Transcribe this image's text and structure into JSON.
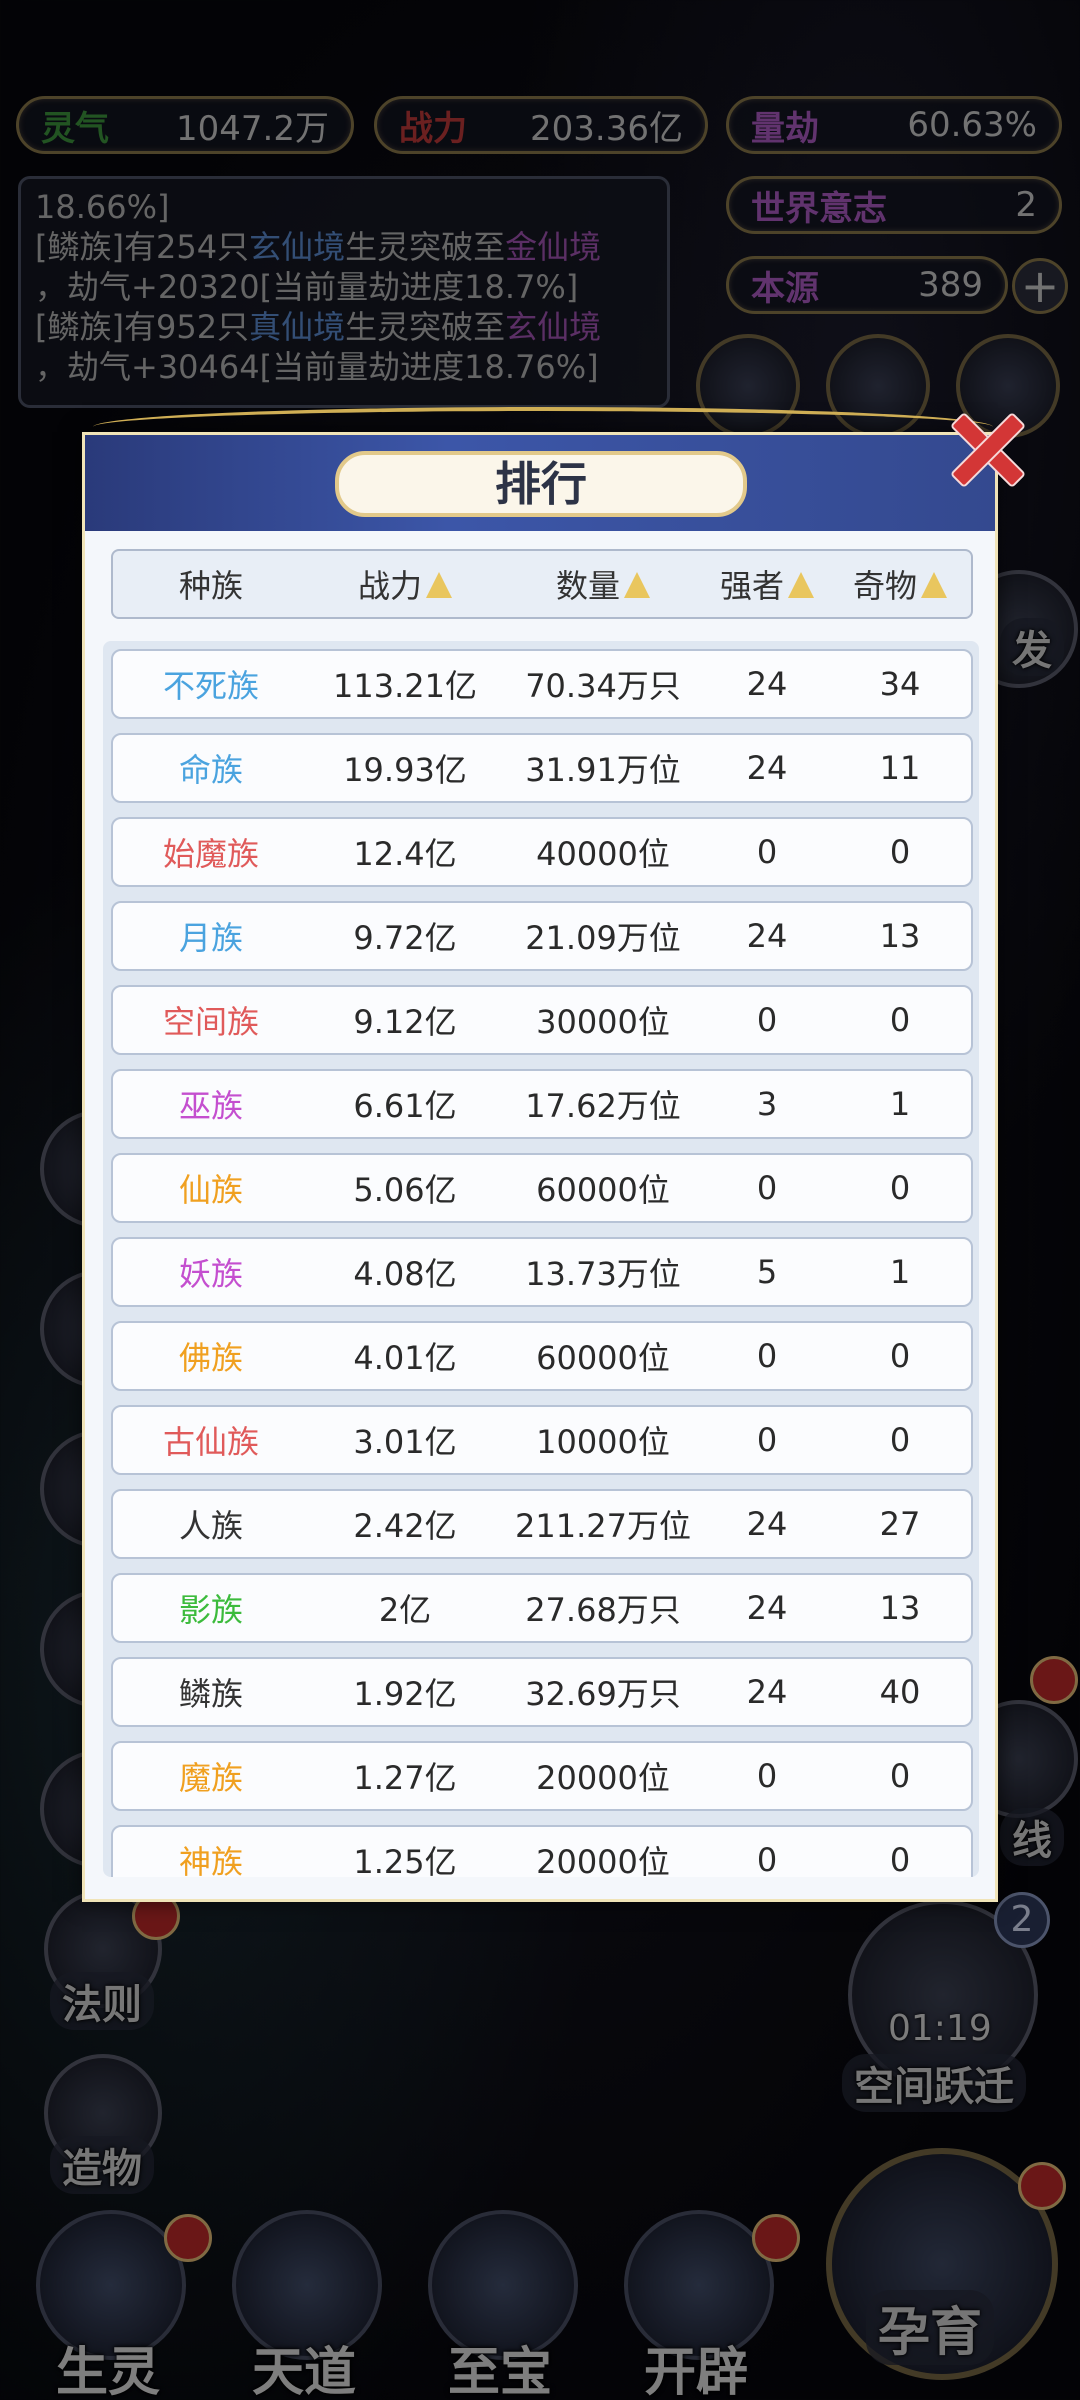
{
  "hud": {
    "lingqi": {
      "label": "灵气",
      "value": "1047.2万"
    },
    "zhanli": {
      "label": "战力",
      "value": "203.36亿"
    },
    "liangjie": {
      "label": "量劫",
      "value": "60.63%"
    },
    "shijie": {
      "label": "世界意志",
      "value": "2"
    },
    "benyuan": {
      "label": "本源",
      "value": "389"
    },
    "plus": "+"
  },
  "colors": {
    "lingqi_label": "#3f9a3f",
    "zhanli_label": "#c43b3b",
    "purple_label": "#b15ec8",
    "gold": "#e9c65e"
  },
  "log": {
    "line0": "18.66%]",
    "e1": {
      "a": "[鳞族]有254只",
      "b": "玄仙境",
      "c": "生灵突破至",
      "d": "金仙境",
      "e": "，劫气+20320[当前量劫进度18.7%]"
    },
    "e2": {
      "a": "[鳞族]有952只",
      "b": "真仙境",
      "c": "生灵突破至",
      "d": "玄仙境",
      "e": "，劫气+30464[当前量劫进度18.76%]"
    }
  },
  "side": {
    "fa_ze": "法则",
    "zao_wu": "造物",
    "ji_fa": "发",
    "xian": "线",
    "space_jump": "空间跃迁",
    "timer": "01:19",
    "count": "2"
  },
  "bottom_nav": [
    "生灵",
    "天道",
    "至宝",
    "开辟"
  ],
  "big_button": "孕育",
  "modal": {
    "title": "排行",
    "headers": [
      "种族",
      "战力",
      "数量",
      "强者",
      "奇物"
    ],
    "rows": [
      {
        "name": "不死族",
        "power": "113.21亿",
        "count": "70.34万只",
        "elite": "24",
        "relic": "34",
        "color": "#4aa3df"
      },
      {
        "name": "命族",
        "power": "19.93亿",
        "count": "31.91万位",
        "elite": "24",
        "relic": "11",
        "color": "#4aa3df"
      },
      {
        "name": "始魔族",
        "power": "12.4亿",
        "count": "40000位",
        "elite": "0",
        "relic": "0",
        "color": "#e05a5a"
      },
      {
        "name": "月族",
        "power": "9.72亿",
        "count": "21.09万位",
        "elite": "24",
        "relic": "13",
        "color": "#4aa3df"
      },
      {
        "name": "空间族",
        "power": "9.12亿",
        "count": "30000位",
        "elite": "0",
        "relic": "0",
        "color": "#e05a5a"
      },
      {
        "name": "巫族",
        "power": "6.61亿",
        "count": "17.62万位",
        "elite": "3",
        "relic": "1",
        "color": "#c44fcf"
      },
      {
        "name": "仙族",
        "power": "5.06亿",
        "count": "60000位",
        "elite": "0",
        "relic": "0",
        "color": "#f0a020"
      },
      {
        "name": "妖族",
        "power": "4.08亿",
        "count": "13.73万位",
        "elite": "5",
        "relic": "1",
        "color": "#c44fcf"
      },
      {
        "name": "佛族",
        "power": "4.01亿",
        "count": "60000位",
        "elite": "0",
        "relic": "0",
        "color": "#f0a020"
      },
      {
        "name": "古仙族",
        "power": "3.01亿",
        "count": "10000位",
        "elite": "0",
        "relic": "0",
        "color": "#e05a5a"
      },
      {
        "name": "人族",
        "power": "2.42亿",
        "count": "211.27万位",
        "elite": "24",
        "relic": "27",
        "color": "#333333"
      },
      {
        "name": "影族",
        "power": "2亿",
        "count": "27.68万只",
        "elite": "24",
        "relic": "13",
        "color": "#3cbb3c"
      },
      {
        "name": "鳞族",
        "power": "1.92亿",
        "count": "32.69万只",
        "elite": "24",
        "relic": "40",
        "color": "#333333"
      },
      {
        "name": "魔族",
        "power": "1.27亿",
        "count": "20000位",
        "elite": "0",
        "relic": "0",
        "color": "#f0a020"
      },
      {
        "name": "神族",
        "power": "1.25亿",
        "count": "20000位",
        "elite": "0",
        "relic": "0",
        "color": "#f0a020"
      }
    ]
  }
}
